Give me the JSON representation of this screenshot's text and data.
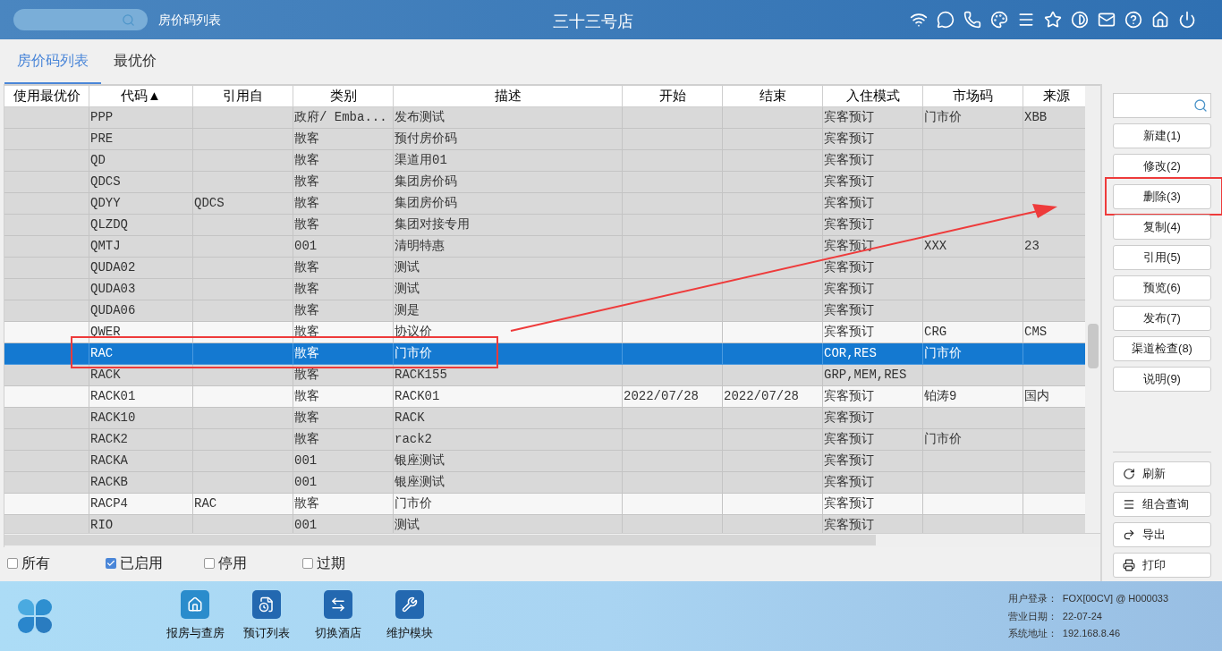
{
  "header": {
    "page_title": "房价码列表",
    "hotel_name": "三十三号店"
  },
  "tabs": [
    {
      "label": "房价码列表",
      "selected": true
    },
    {
      "label": "最优价",
      "selected": false
    }
  ],
  "table": {
    "columns": [
      "使用最优价",
      "代码▲",
      "引用自",
      "类别",
      "描述",
      "开始",
      "结束",
      "入住模式",
      "市场码",
      "来源"
    ],
    "rows": [
      {
        "cells": [
          "",
          "PPP",
          "",
          "政府/ Emba...",
          "发布测试",
          "",
          "",
          "宾客预订",
          "门市价",
          "XBB"
        ],
        "shaded": true,
        "selected": false,
        "annotated": false
      },
      {
        "cells": [
          "",
          "PRE",
          "",
          "散客",
          "预付房价码",
          "",
          "",
          "宾客预订",
          "",
          ""
        ],
        "shaded": true,
        "selected": false,
        "annotated": false
      },
      {
        "cells": [
          "",
          "QD",
          "",
          "散客",
          "渠道用01",
          "",
          "",
          "宾客预订",
          "",
          ""
        ],
        "shaded": true,
        "selected": false,
        "annotated": false
      },
      {
        "cells": [
          "",
          "QDCS",
          "",
          "散客",
          "集团房价码",
          "",
          "",
          "宾客预订",
          "",
          ""
        ],
        "shaded": true,
        "selected": false,
        "annotated": false
      },
      {
        "cells": [
          "",
          "QDYY",
          "QDCS",
          "散客",
          "集团房价码",
          "",
          "",
          "宾客预订",
          "",
          ""
        ],
        "shaded": true,
        "selected": false,
        "annotated": false
      },
      {
        "cells": [
          "",
          "QLZDQ",
          "",
          "散客",
          "集团对接专用",
          "",
          "",
          "宾客预订",
          "",
          ""
        ],
        "shaded": true,
        "selected": false,
        "annotated": false
      },
      {
        "cells": [
          "",
          "QMTJ",
          "",
          "001",
          "清明特惠",
          "",
          "",
          "宾客预订",
          "XXX",
          "23"
        ],
        "shaded": true,
        "selected": false,
        "annotated": false
      },
      {
        "cells": [
          "",
          "QUDA02",
          "",
          "散客",
          "测试",
          "",
          "",
          "宾客预订",
          "",
          ""
        ],
        "shaded": true,
        "selected": false,
        "annotated": false
      },
      {
        "cells": [
          "",
          "QUDA03",
          "",
          "散客",
          "测试",
          "",
          "",
          "宾客预订",
          "",
          ""
        ],
        "shaded": true,
        "selected": false,
        "annotated": false
      },
      {
        "cells": [
          "",
          "QUDA06",
          "",
          "散客",
          "测是",
          "",
          "",
          "宾客预订",
          "",
          ""
        ],
        "shaded": true,
        "selected": false,
        "annotated": false
      },
      {
        "cells": [
          "",
          "QWER",
          "",
          "散客",
          "协议价",
          "",
          "",
          "宾客预订",
          "CRG",
          "CMS"
        ],
        "shaded": false,
        "selected": false,
        "annotated": false
      },
      {
        "cells": [
          "",
          "RAC",
          "",
          "散客",
          "门市价",
          "",
          "",
          "COR,RES",
          "门市价",
          ""
        ],
        "selected": true,
        "annotated": true
      },
      {
        "cells": [
          "",
          "RACK",
          "",
          "散客",
          "RACK155",
          "",
          "",
          "GRP,MEM,RES",
          "",
          ""
        ],
        "shaded": true,
        "selected": false,
        "annotated": false
      },
      {
        "cells": [
          "",
          "RACK01",
          "",
          "散客",
          "RACK01",
          "2022/07/28",
          "2022/07/28",
          "宾客预订",
          "铂涛9",
          "国内"
        ],
        "shaded": false,
        "selected": false,
        "annotated": false
      },
      {
        "cells": [
          "",
          "RACK10",
          "",
          "散客",
          "RACK",
          "",
          "",
          "宾客预订",
          "",
          ""
        ],
        "shaded": true,
        "selected": false,
        "annotated": false
      },
      {
        "cells": [
          "",
          "RACK2",
          "",
          "散客",
          "rack2",
          "",
          "",
          "宾客预订",
          "门市价",
          ""
        ],
        "shaded": true,
        "selected": false,
        "annotated": false
      },
      {
        "cells": [
          "",
          "RACKA",
          "",
          "001",
          "银座测试",
          "",
          "",
          "宾客预订",
          "",
          ""
        ],
        "shaded": true,
        "selected": false,
        "annotated": false
      },
      {
        "cells": [
          "",
          "RACKB",
          "",
          "001",
          "银座测试",
          "",
          "",
          "宾客预订",
          "",
          ""
        ],
        "shaded": true,
        "selected": false,
        "annotated": false
      },
      {
        "cells": [
          "",
          "RACP4",
          "RAC",
          "散客",
          "门市价",
          "",
          "",
          "宾客预订",
          "",
          ""
        ],
        "shaded": false,
        "selected": false,
        "annotated": false
      },
      {
        "cells": [
          "",
          "RIO",
          "",
          "001",
          "测试",
          "",
          "",
          "宾客预订",
          "",
          ""
        ],
        "shaded": true,
        "selected": false,
        "annotated": false
      }
    ]
  },
  "filters": [
    {
      "label": "所有",
      "checked": false
    },
    {
      "label": "已启用",
      "checked": true
    },
    {
      "label": "停用",
      "checked": false
    },
    {
      "label": "过期",
      "checked": false
    }
  ],
  "actions": [
    {
      "label": "新建(1)",
      "annotated": false
    },
    {
      "label": "修改(2)",
      "annotated": false
    },
    {
      "label": "删除(3)",
      "annotated": true
    },
    {
      "label": "复制(4)",
      "annotated": false
    },
    {
      "label": "引用(5)",
      "annotated": false
    },
    {
      "label": "预览(6)",
      "annotated": false
    },
    {
      "label": "发布(7)",
      "annotated": false
    },
    {
      "label": "渠道检查(8)",
      "annotated": false
    },
    {
      "label": "说明(9)",
      "annotated": false
    }
  ],
  "tools": [
    {
      "label": "刷新",
      "kind": "refresh"
    },
    {
      "label": "组合查询",
      "kind": "query"
    },
    {
      "label": "导出",
      "kind": "export"
    },
    {
      "label": "打印",
      "kind": "print"
    }
  ],
  "footer": {
    "modules": [
      {
        "label": "报房与查房",
        "kind": "room"
      },
      {
        "label": "预订列表",
        "kind": "booking"
      },
      {
        "label": "切换酒店",
        "kind": "switch"
      },
      {
        "label": "维护模块",
        "kind": "maintain"
      }
    ],
    "info": [
      {
        "label": "用户登录：",
        "value": "FOX[00CV] @ H000033"
      },
      {
        "label": "营业日期：",
        "value": "22-07-24"
      },
      {
        "label": "系统地址：",
        "value": "192.168.8.46"
      }
    ]
  }
}
